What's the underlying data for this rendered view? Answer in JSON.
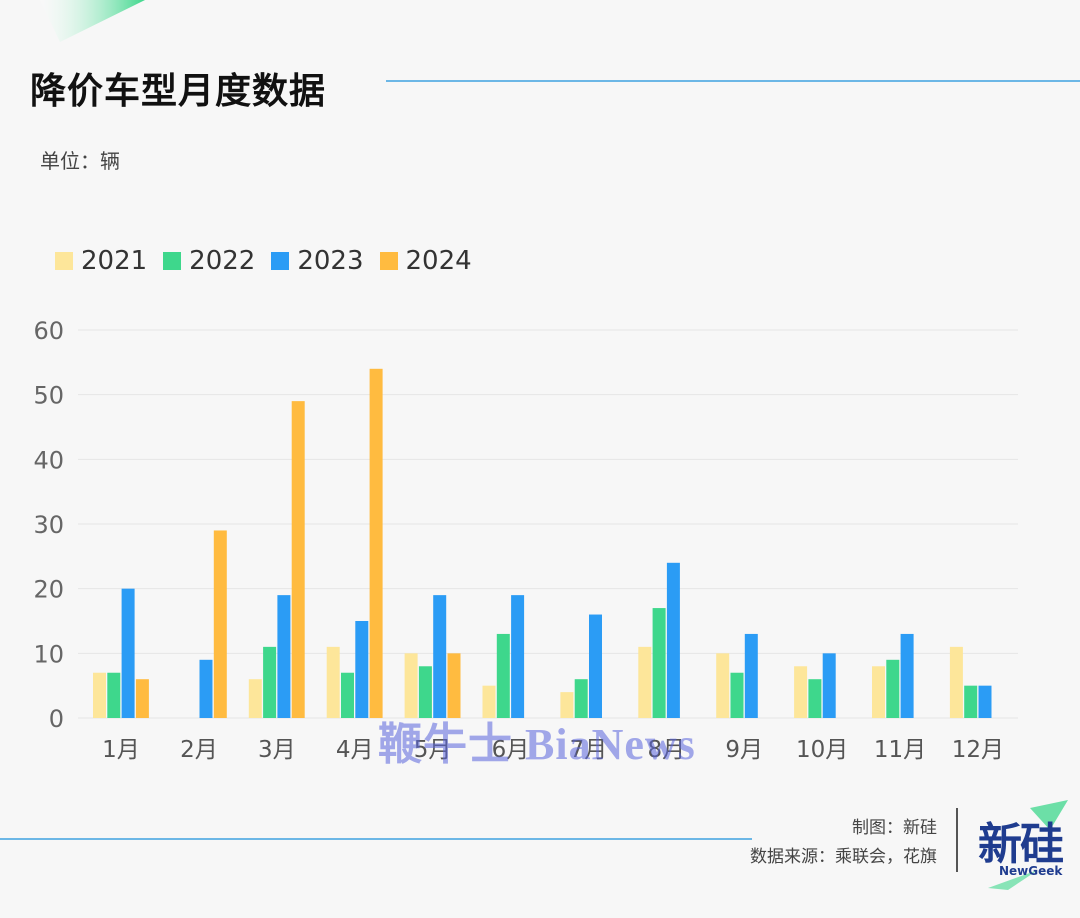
{
  "header": {
    "title": "降价车型月度数据",
    "unit": "单位：辆"
  },
  "watermark": "鞭牛士 BiaNews",
  "footer": {
    "credit_line1": "制图：新硅",
    "credit_line2": "数据来源：乘联会，花旗",
    "logo_main": "新硅",
    "logo_sub": "NewGeek"
  },
  "colors": {
    "s2021": "#fde69a",
    "s2022": "#3ed78c",
    "s2023": "#2b9cf5",
    "s2024": "#ffbb40",
    "accent_line": "#6cb7e6",
    "logo": "#1f3c8f"
  },
  "chart_data": {
    "type": "bar",
    "categories": [
      "1月",
      "2月",
      "3月",
      "4月",
      "5月",
      "6月",
      "7月",
      "8月",
      "9月",
      "10月",
      "11月",
      "12月"
    ],
    "series": [
      {
        "name": "2021",
        "values": [
          7,
          null,
          6,
          11,
          10,
          5,
          4,
          11,
          10,
          8,
          8,
          11
        ]
      },
      {
        "name": "2022",
        "values": [
          7,
          null,
          11,
          7,
          8,
          13,
          6,
          17,
          7,
          6,
          9,
          5
        ]
      },
      {
        "name": "2023",
        "values": [
          20,
          9,
          19,
          15,
          19,
          19,
          16,
          24,
          13,
          10,
          13,
          5
        ]
      },
      {
        "name": "2024",
        "values": [
          6,
          29,
          49,
          54,
          10,
          null,
          null,
          null,
          null,
          null,
          null,
          null
        ]
      }
    ],
    "yticks": [
      0,
      10,
      20,
      30,
      40,
      50,
      60
    ],
    "ylim": [
      0,
      60
    ],
    "grid": true,
    "legend_position": "top-left"
  }
}
